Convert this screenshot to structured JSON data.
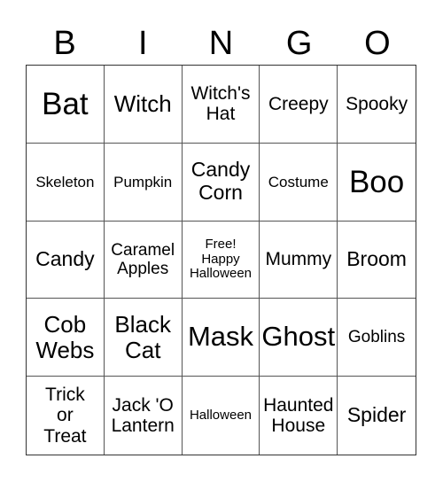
{
  "header": {
    "letters": [
      "B",
      "I",
      "N",
      "G",
      "O"
    ]
  },
  "cells": [
    "Bat",
    "Witch",
    "Witch's\nHat",
    "Creepy",
    "Spooky",
    "Skeleton",
    "Pumpkin",
    "Candy\nCorn",
    "Costume",
    "Boo",
    "Candy",
    "Caramel\nApples",
    "Free!\nHappy\nHalloween",
    "Mummy",
    "Broom",
    "Cob\nWebs",
    "Black\nCat",
    "Mask",
    "Ghost",
    "Goblins",
    "Trick\nor\nTreat",
    "Jack 'O\nLantern",
    "Halloween",
    "Haunted\nHouse",
    "Spider"
  ],
  "free_space": {
    "index": 12
  }
}
